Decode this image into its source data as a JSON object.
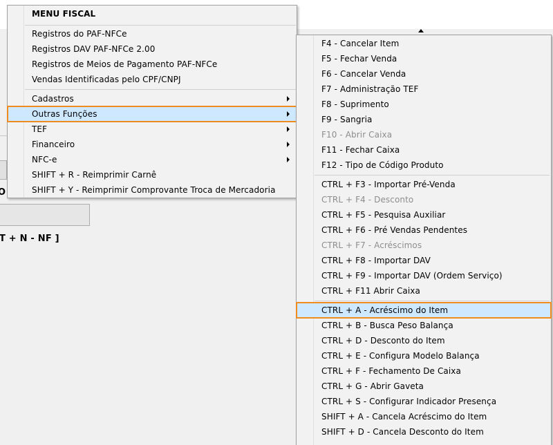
{
  "background": {
    "partial_label": "O",
    "shortcut_text": "T + N - NF ]"
  },
  "main_menu": {
    "header": "MENU FISCAL",
    "items": [
      {
        "label": "Registros do PAF-NFCe"
      },
      {
        "label": "Registros DAV PAF-NFCe 2.00"
      },
      {
        "label": "Registros de Meios de Pagamento PAF-NFCe"
      },
      {
        "label": "Vendas Identificadas pelo CPF/CNPJ"
      },
      {
        "label": "Cadastros",
        "submenu": true
      },
      {
        "label": "Outras Funções",
        "submenu": true,
        "selected": true
      },
      {
        "label": "TEF",
        "submenu": true
      },
      {
        "label": "Financeiro",
        "submenu": true
      },
      {
        "label": "NFC-e",
        "submenu": true
      },
      {
        "label": "SHIFT + R - Reimprimir Carnê"
      },
      {
        "label": "SHIFT + Y - Reimprimir Comprovante Troca de Mercadoria"
      }
    ]
  },
  "sub_menu": {
    "items": [
      {
        "label": "F4 - Cancelar Item"
      },
      {
        "label": "F5 - Fechar Venda"
      },
      {
        "label": "F6 - Cancelar Venda"
      },
      {
        "label": "F7 - Administração TEF"
      },
      {
        "label": "F8 - Suprimento"
      },
      {
        "label": "F9 - Sangria"
      },
      {
        "label": "F10 - Abrir Caixa",
        "disabled": true
      },
      {
        "label": "F11 - Fechar Caixa"
      },
      {
        "label": "F12 - Tipo de Código Produto"
      },
      {
        "label": "CTRL + F3 - Importar Pré-Venda"
      },
      {
        "label": "CTRL + F4 - Desconto",
        "disabled": true
      },
      {
        "label": "CTRL + F5 - Pesquisa Auxiliar"
      },
      {
        "label": "CTRL + F6 - Pré Vendas Pendentes"
      },
      {
        "label": "CTRL + F7 - Acréscimos",
        "disabled": true
      },
      {
        "label": "CTRL + F8 - Importar DAV"
      },
      {
        "label": "CTRL + F9 - Importar DAV (Ordem Serviço)"
      },
      {
        "label": "CTRL + F11 Abrir Caixa"
      },
      {
        "label": "CTRL + A - Acréscimo do Item",
        "selected": true
      },
      {
        "label": "CTRL + B - Busca Peso Balança"
      },
      {
        "label": "CTRL + D - Desconto do Item"
      },
      {
        "label": "CTRL + E - Configura Modelo Balança"
      },
      {
        "label": "CTRL + F - Fechamento De Caixa"
      },
      {
        "label": "CTRL + G - Abrir Gaveta"
      },
      {
        "label": "CTRL + S - Configurar Indicador Presença"
      },
      {
        "label": "SHIFT + A - Cancela Acréscimo do Item"
      },
      {
        "label": "SHIFT + D - Cancela Desconto do Item"
      }
    ]
  },
  "colors": {
    "highlight_fill": "#cde8ff",
    "highlight_border": "#f08c1e",
    "disabled_text": "#8d8d8d",
    "menu_background": "#f2f2f2"
  }
}
